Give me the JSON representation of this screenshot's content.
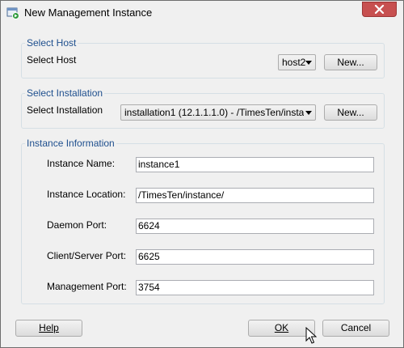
{
  "window": {
    "title": "New Management Instance"
  },
  "select_host": {
    "group_title": "Select Host",
    "label": "Select Host",
    "combo_value": "host2",
    "new_button": "New..."
  },
  "select_installation": {
    "group_title": "Select Installation",
    "label": "Select Installation",
    "combo_value": "installation1 (12.1.1.1.0) - /TimesTen/install...",
    "new_button": "New..."
  },
  "instance_info": {
    "group_title": "Instance Information",
    "fields": [
      {
        "label": "Instance Name:",
        "value": "instance1"
      },
      {
        "label": "Instance Location:",
        "value": "/TimesTen/instance/"
      },
      {
        "label": "Daemon Port:",
        "value": "6624"
      },
      {
        "label": "Client/Server Port:",
        "value": "6625"
      },
      {
        "label": "Management Port:",
        "value": "3754"
      }
    ]
  },
  "footer": {
    "help_button": "Help",
    "ok_button": "OK",
    "cancel_button": "Cancel"
  },
  "icons": {
    "app": "app-window-icon",
    "close": "close-icon",
    "cursor": "mouse-pointer-icon"
  },
  "colors": {
    "group_title": "#1e4f8e",
    "close_button": "#c75050"
  }
}
